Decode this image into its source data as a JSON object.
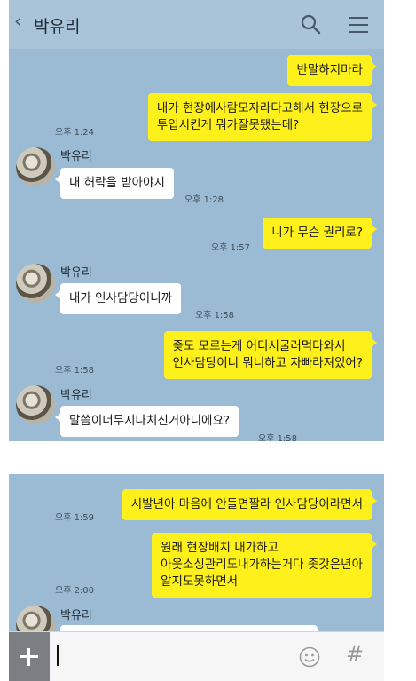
{
  "header": {
    "back_glyph": "‹",
    "title": "박유리",
    "search_icon": "search-icon",
    "menu_icon": "menu-icon"
  },
  "messages_top": [
    {
      "type": "sent",
      "text": [
        "반말하지마라"
      ],
      "time": ""
    },
    {
      "type": "sent",
      "text": [
        "내가 현장에사람모자라다고해서 현장으로",
        "투입시킨게 뭐가잘못됐는데?"
      ],
      "time": "오후 1:24"
    },
    {
      "type": "received",
      "sender": "박유리",
      "text": [
        "내 허락을 받아야지"
      ],
      "time": "오후 1:28"
    },
    {
      "type": "sent",
      "text": [
        "니가 무슨 권리로?"
      ],
      "time": "오후 1:57"
    },
    {
      "type": "received",
      "sender": "박유리",
      "text": [
        "내가 인사담당이니까"
      ],
      "time": "오후 1:58"
    },
    {
      "type": "sent",
      "text": [
        "좆도 모르는게 어디서굴러먹다와서",
        "인사담당이니 뭐니하고 자빠라져있어?"
      ],
      "time": "오후 1:58"
    },
    {
      "type": "received",
      "sender": "박유리",
      "text": [
        "말씀이너무지나치신거아니에요?"
      ],
      "time": "오후 1:58"
    }
  ],
  "messages_bottom": [
    {
      "type": "sent",
      "text": [
        "시발년아 마음에 안들면짤라 인사담당이라면서"
      ],
      "time": "오후 1:59"
    },
    {
      "type": "sent",
      "text": [
        "원래 현장배치 내가하고",
        "아웃소싱관리도내가하는거다 좃갓은년아",
        "알지도못하면서"
      ],
      "time": "오후 2:00"
    },
    {
      "type": "received",
      "sender": "박유리",
      "text": [
        ""
      ],
      "time": ""
    }
  ],
  "input_bar": {
    "plus_icon": "plus-icon",
    "value": "",
    "emoji_icon": "emoji-icon",
    "hash_glyph": "#"
  },
  "colors": {
    "chat_background": "#9bbbd4",
    "sent_bubble": "#fef01b",
    "received_bubble": "#ffffff"
  }
}
